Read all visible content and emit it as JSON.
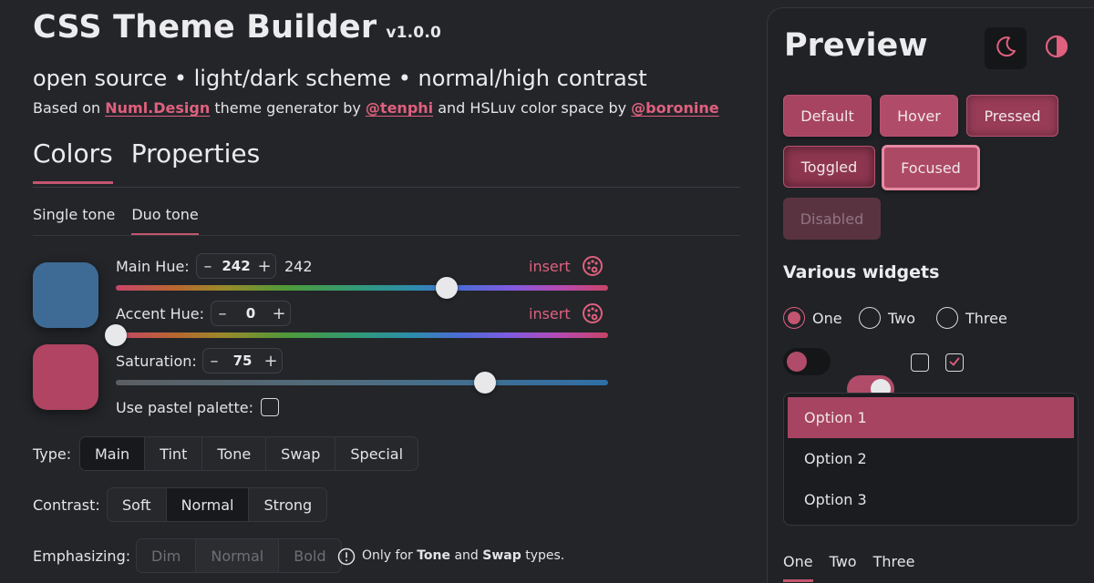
{
  "header": {
    "title": "CSS Theme Builder",
    "version": "v1.0.0",
    "subtitle": "open source • light/dark scheme • normal/high contrast",
    "credits": {
      "prefix": "Based on",
      "link1": "Numl.Design",
      "middle1": "theme generator by",
      "link2": "@tenphi",
      "middle2": "and HSLuv color space by",
      "link3": "@boronine"
    }
  },
  "main_tabs": [
    {
      "label": "Colors",
      "active": true
    },
    {
      "label": "Properties",
      "active": false
    }
  ],
  "sub_tabs": [
    {
      "label": "Single tone",
      "active": false
    },
    {
      "label": "Duo tone",
      "active": true
    }
  ],
  "swatches": {
    "main_color": "#3e6b96",
    "accent_color": "#b04462"
  },
  "controls": {
    "main_hue": {
      "label": "Main Hue:",
      "value": "242",
      "readout": "242",
      "insert": "insert",
      "fraction": 0.673
    },
    "accent_hue": {
      "label": "Accent Hue:",
      "value": "0",
      "insert": "insert",
      "fraction": 0.0
    },
    "saturation": {
      "label": "Saturation:",
      "value": "75",
      "fraction": 0.75
    },
    "pastel": {
      "label": "Use pastel palette:",
      "checked": false
    },
    "stepper_minus": "–",
    "stepper_plus": "+"
  },
  "type": {
    "label": "Type:",
    "options": [
      "Main",
      "Tint",
      "Tone",
      "Swap",
      "Special"
    ],
    "selected": "Main"
  },
  "contrast": {
    "label": "Contrast:",
    "options": [
      "Soft",
      "Normal",
      "Strong"
    ],
    "selected": "Normal"
  },
  "emphasizing": {
    "label": "Emphasizing:",
    "options": [
      "Dim",
      "Normal",
      "Bold"
    ],
    "selected": "Normal",
    "note_prefix": "Only for",
    "note_b1": "Tone",
    "note_mid": "and",
    "note_b2": "Swap",
    "note_suffix": "types."
  },
  "preview": {
    "title": "Preview",
    "buttons": {
      "default": "Default",
      "hover": "Hover",
      "pressed": "Pressed",
      "toggled": "Toggled",
      "focused": "Focused",
      "disabled": "Disabled"
    },
    "widgets_title": "Various widgets",
    "radios": [
      {
        "label": "One",
        "selected": true
      },
      {
        "label": "Two",
        "selected": false
      },
      {
        "label": "Three",
        "selected": false
      }
    ],
    "list": [
      {
        "label": "Option 1",
        "selected": true
      },
      {
        "label": "Option 2",
        "selected": false
      },
      {
        "label": "Option 3",
        "selected": false
      }
    ],
    "tabs": [
      {
        "label": "One",
        "active": true
      },
      {
        "label": "Two",
        "active": false
      },
      {
        "label": "Three",
        "active": false
      }
    ]
  },
  "colors": {
    "accent": "#c45570",
    "link": "#e0607e",
    "background": "#232529"
  }
}
